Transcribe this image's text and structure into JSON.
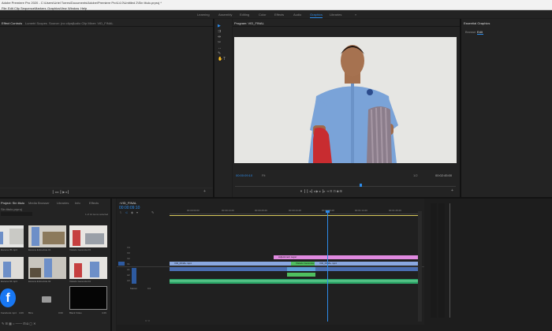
{
  "titlebar": {
    "text": "Adobe Premiere Pro 2020 - C:\\Users\\Uriel Torres\\Documents\\Adobe\\Premiere Pro\\14.0\\Untitled 2\\Sin titulo.prproj *"
  },
  "menu": [
    "File",
    "Edit",
    "Clip",
    "Sequence",
    "Markers",
    "Graphics",
    "View",
    "Window",
    "Help"
  ],
  "workspaces": [
    "Learning",
    "Assembly",
    "Editing",
    "Color",
    "Effects",
    "Audio",
    "Graphics",
    "Libraries"
  ],
  "workspace_active": "Graphics",
  "source_tabs": [
    "Effect Controls",
    "Lumetri Scopes",
    "Source: (no clips)",
    "Audio Clip Mixer: VID_FINAL"
  ],
  "program": {
    "tab": "Program: VID_FINAL",
    "timecode_left": "00:00:09:10",
    "fit": "Fit",
    "quality": "1/2",
    "timecode_right": "00:02:45:00"
  },
  "essential_graphics": {
    "tab": "Essential Graphics",
    "browse": "Browse",
    "edit": "Edit"
  },
  "project": {
    "tabs": [
      "Project: Sin titulo",
      "Media Browser",
      "Libraries",
      "Info",
      "Effects"
    ],
    "path": "Sin titulo.prproj",
    "items_count": "1 of 12 items selected",
    "thumbs": [
      {
        "label": "Escena 05.mp4"
      },
      {
        "label": "Escena Entrevista 01"
      },
      {
        "label": "Vistazo Gerencia 03"
      },
      {
        "label": "Escena 04.mp4"
      },
      {
        "label": "Escena Entrevista 02"
      },
      {
        "label": "Vistazo Gerencia 04"
      },
      {
        "label": "Facebook.mp4"
      },
      {
        "label": "Bins"
      },
      {
        "label": "Black Video"
      }
    ],
    "durations": [
      "4:29",
      "0:00",
      "4:29"
    ]
  },
  "timeline": {
    "tab": "VID_FINAL",
    "timecode": "00:00:09:10",
    "ruler": [
      "00:00:00:00",
      "00:00:14:29",
      "00:00:29:29",
      "00:00:44:28",
      "00:00:59:28",
      "00:01:14:29",
      "00:01:29:29"
    ],
    "tracks_video": [
      "V4",
      "V3",
      "V2",
      "V1"
    ],
    "tracks_audio": [
      "A1",
      "A2",
      "A3"
    ],
    "master": "Master",
    "master_val": "0.0",
    "clips": {
      "pink": "Adjustment Layer",
      "green_small": "Vistazo Gerencia 01",
      "blue1": "VID_FINAL.mp4",
      "blue2": "VID_FINAL.mp4"
    }
  },
  "colors": {
    "accent": "#2d8ceb",
    "clip_pink": "#e08ae0",
    "clip_blue": "#8aa8e0",
    "clip_green": "#4fbf5f",
    "audio_green": "#2fa86a"
  },
  "icons": [
    "selection-tool-icon",
    "track-select-icon",
    "ripple-edit-icon",
    "razor-icon",
    "slip-icon",
    "pen-icon",
    "hand-icon",
    "type-icon",
    "play-icon",
    "facebook-icon",
    "folder-icon"
  ]
}
